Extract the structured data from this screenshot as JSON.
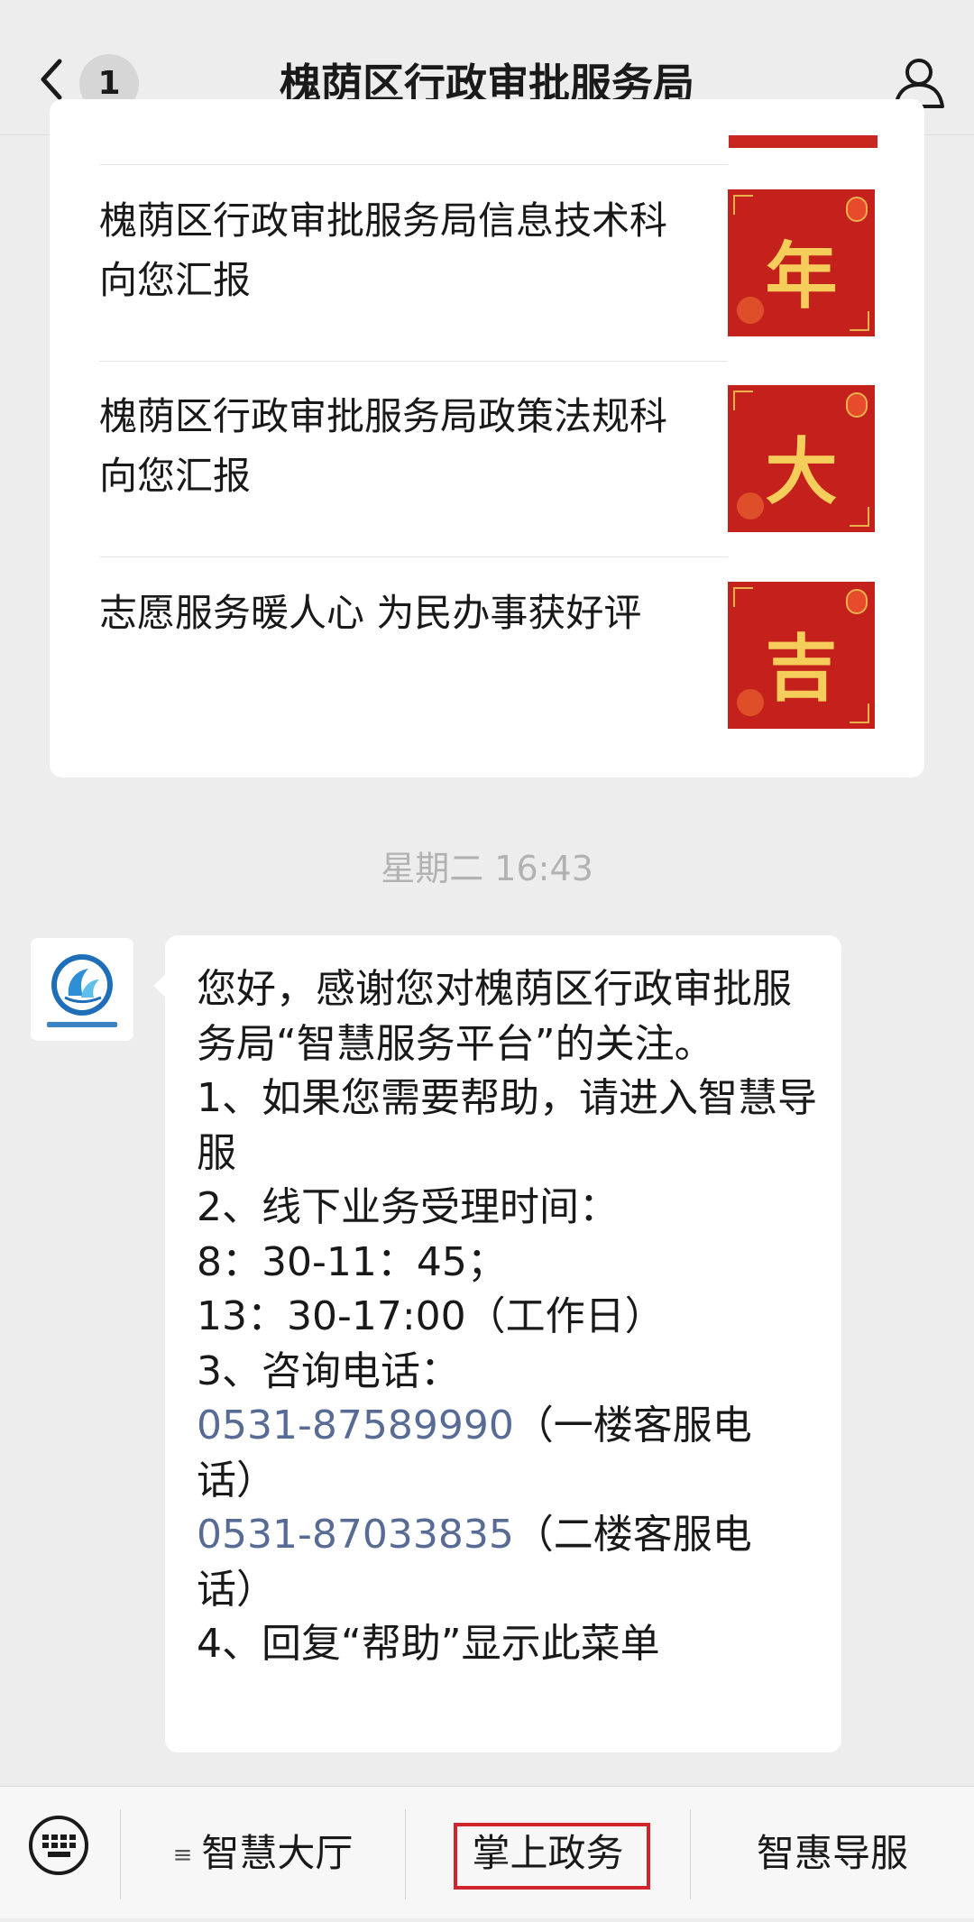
{
  "header": {
    "back_icon": "chevron-left-icon",
    "unread_count": "1",
    "title": "槐荫区行政审批服务局",
    "profile_icon": "person-icon"
  },
  "articles": [
    {
      "title": "槐荫区行政审批服务局信息技术科向您汇报",
      "thumb_char": "年"
    },
    {
      "title": "槐荫区行政审批服务局政策法规科向您汇报",
      "thumb_char": "大"
    },
    {
      "title": "志愿服务暖人心  为民办事获好评",
      "thumb_char": "吉"
    }
  ],
  "timestamp": "星期二 16:43",
  "message": {
    "intro": "您好，感谢您对槐荫区行政审批服务局“智慧服务平台”的关注。",
    "item1": "1、如果您需要帮助，请进入智慧导服",
    "item2_title": "2、线下业务受理时间：",
    "item2_time1": "8：30-11：45；",
    "item2_time2": "13：30-17:00（工作日）",
    "item3_title": "3、咨询电话：",
    "phone1": "0531-87589990",
    "phone1_note": "（一楼客服电话）",
    "phone2": "0531-87033835",
    "phone2_note": "（二楼客服电话）",
    "item4": "4、回复“帮助”显示此菜单"
  },
  "bottom_menu": {
    "keyboard_icon": "keyboard-icon",
    "items": [
      {
        "label": "智慧大厅",
        "has_submenu": true
      },
      {
        "label": "掌上政务",
        "highlighted": true
      },
      {
        "label": "智惠导服"
      }
    ]
  },
  "colors": {
    "link": "#576b95",
    "highlight": "#d0252c",
    "thumb_red": "#c4211c",
    "thumb_gold": "#f5cd5b"
  }
}
